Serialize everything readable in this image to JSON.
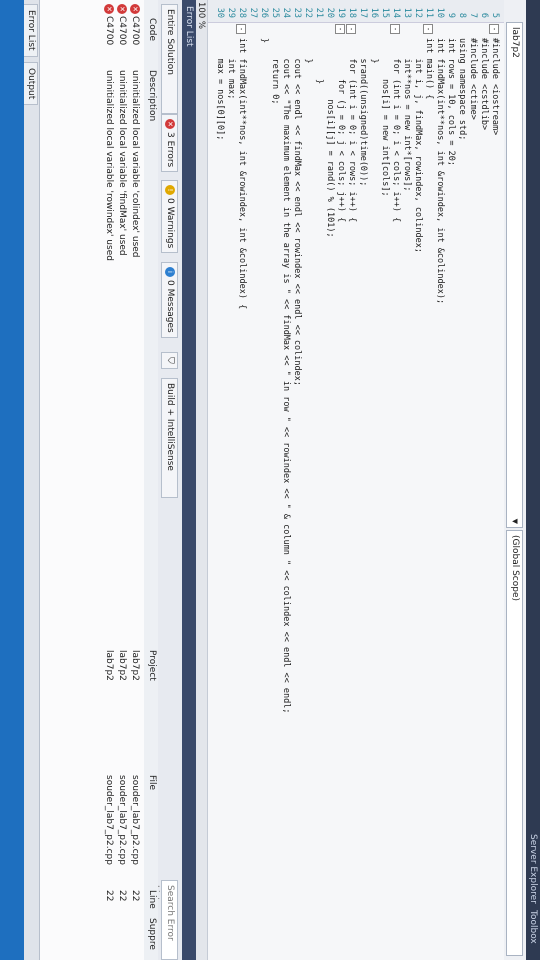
{
  "tool_strip": {
    "tabs": [
      "Toolbox",
      "Server Explorer"
    ]
  },
  "editor_header": {
    "file_combo": "lab7p2",
    "scope_combo": "(Global Scope)"
  },
  "code_lines": [
    {
      "n": "5",
      "text": "#include <iostream>",
      "fold": "-"
    },
    {
      "n": "6",
      "text": "#include <cstdlib>",
      "fold": ""
    },
    {
      "n": "7",
      "text": "#include <ctime>",
      "fold": ""
    },
    {
      "n": "8",
      "text": "using namespace std;",
      "fold": ""
    },
    {
      "n": "9",
      "text": "int rows = 10, cols = 20;",
      "fold": ""
    },
    {
      "n": "10",
      "text": "int findMax(int**nos, int &rowindex, int &colindex);",
      "fold": ""
    },
    {
      "n": "11",
      "text": "int main() {",
      "fold": "-"
    },
    {
      "n": "12",
      "text": "    int i, j, findMax, rowindex, colindex;",
      "fold": ""
    },
    {
      "n": "13",
      "text": "    int**nos = new int*[rows];",
      "fold": ""
    },
    {
      "n": "14",
      "text": "    for (int i = 0; i < cols; i++) {",
      "fold": "-"
    },
    {
      "n": "15",
      "text": "        nos[i] = new int[cols];",
      "fold": ""
    },
    {
      "n": "16",
      "text": "    }",
      "fold": ""
    },
    {
      "n": "17",
      "text": "    srand((unsigned)time(0));",
      "fold": ""
    },
    {
      "n": "18",
      "text": "    for (int i = 0; i < rows; i++) {",
      "fold": "-"
    },
    {
      "n": "19",
      "text": "        for (j = 0; j < cols; j++) {",
      "fold": "-"
    },
    {
      "n": "20",
      "text": "            nos[i][j] = rand() % (101);",
      "fold": ""
    },
    {
      "n": "21",
      "text": "        }",
      "fold": ""
    },
    {
      "n": "22",
      "text": "    }",
      "fold": ""
    },
    {
      "n": "23",
      "text": "    cout << endl << findMax << endl << rowindex << endl << colindex;",
      "fold": ""
    },
    {
      "n": "24",
      "text": "    cout << \"The maximum element in the array is \" << findMax << \" in row \" << rowindex << \" & column \" << colindex << endl << endl;",
      "fold": ""
    },
    {
      "n": "25",
      "text": "    return 0;",
      "fold": ""
    },
    {
      "n": "26",
      "text": "}",
      "fold": ""
    },
    {
      "n": "27",
      "text": "",
      "fold": ""
    },
    {
      "n": "28",
      "text": "int findMax(int**nos, int &rowindex, int &colindex) {",
      "fold": "-"
    },
    {
      "n": "29",
      "text": "    int max;",
      "fold": ""
    },
    {
      "n": "30",
      "text": "    max = nos[0][0];",
      "fold": ""
    }
  ],
  "zoom": "100 %",
  "error_list": {
    "title": "Error List",
    "scope_select": "Entire Solution",
    "errors_btn": "3 Errors",
    "warnings_btn": "0 Warnings",
    "messages_btn": "0 Messages",
    "build_select": "Build + IntelliSense",
    "search_placeholder": "Search Error List",
    "headers": {
      "code": "Code",
      "description": "Description",
      "project": "Project",
      "file": "File",
      "line": "Line",
      "suppression": "Suppre"
    },
    "rows": [
      {
        "code": "C4700",
        "description": "uninitialized local variable 'colindex' used",
        "project": "lab7p2",
        "file": "souder_lab7_p2.cpp",
        "line": "22"
      },
      {
        "code": "C4700",
        "description": "uninitialized local variable 'findMax' used",
        "project": "lab7p2",
        "file": "souder_lab7_p2.cpp",
        "line": "22"
      },
      {
        "code": "C4700",
        "description": "uninitialized local variable 'rowindex' used",
        "project": "lab7p2",
        "file": "souder_lab7_p2.cpp",
        "line": "22"
      }
    ]
  },
  "bottom_tabs": [
    "Error List",
    "Output"
  ],
  "colors": {
    "error": "#d23a3a",
    "warning": "#e0a800",
    "message": "#2d7fd0",
    "status_bar": "#1e6fbf"
  }
}
